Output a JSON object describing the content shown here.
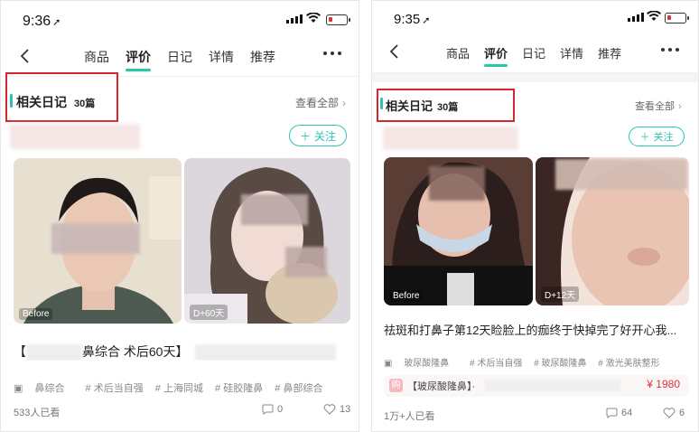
{
  "left": {
    "status": {
      "time": "9:36"
    },
    "nav": {
      "tabs": [
        "商品",
        "评价",
        "日记",
        "详情",
        "推荐"
      ]
    },
    "section": {
      "title": "相关日记",
      "count": "30篇",
      "view_all": "查看全部"
    },
    "follow_label": "关注",
    "photos": [
      {
        "tag": "Before"
      },
      {
        "tag": "D+60天"
      }
    ],
    "post_title_start": "【",
    "post_title_mid": "鼻综合 术后60天】",
    "tags": [
      "鼻综合",
      "# 术后当自强",
      "# 上海同城",
      "# 硅胶隆鼻",
      "# 鼻部综合"
    ],
    "views": "533人已看",
    "comments": "0",
    "likes": "13"
  },
  "right": {
    "status": {
      "time": "9:35"
    },
    "nav": {
      "tabs": [
        "商品",
        "评价",
        "日记",
        "详情",
        "推荐"
      ]
    },
    "section": {
      "title": "相关日记",
      "count": "30篇",
      "view_all": "查看全部"
    },
    "follow_label": "关注",
    "photos": [
      {
        "tag": "Before"
      },
      {
        "tag": "D+12天"
      }
    ],
    "post_title": "祛斑和打鼻子第12天睑脸上的痂终于快掉完了好开心我...",
    "tags": [
      "玻尿酸隆鼻",
      "# 术后当自强",
      "# 玻尿酸隆鼻",
      "# 激光美肤整形"
    ],
    "product": {
      "icon_text": "购",
      "name": "【玻尿酸隆鼻】·",
      "price": "¥ 1980"
    },
    "views": "1万+人已看",
    "comments": "64",
    "likes": "6"
  },
  "colors": {
    "accent": "#2ec3b0",
    "highlight_box": "#d9232d",
    "price": "#e2343d",
    "battery_low": "#e0332e"
  },
  "icons": [
    "location-arrow-icon",
    "signal-icon",
    "wifi-icon",
    "battery-icon",
    "back-chevron-icon",
    "more-dots-icon",
    "chevron-right-icon",
    "plus-icon",
    "diary-icon",
    "comment-icon",
    "heart-icon"
  ]
}
